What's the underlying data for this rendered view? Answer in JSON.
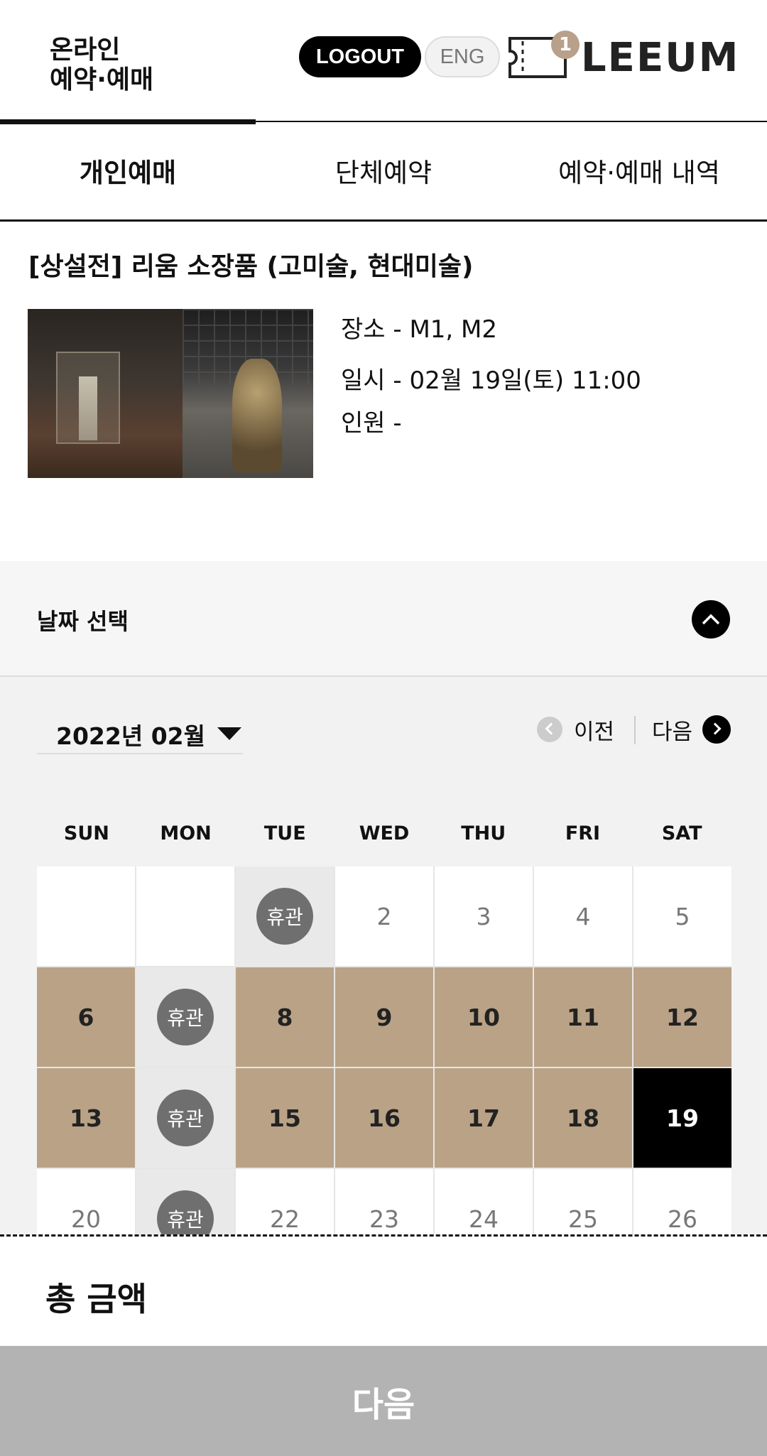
{
  "header": {
    "brand_line1": "온라인",
    "brand_line2": "예약·예매",
    "logout_label": "LOGOUT",
    "lang_label": "ENG",
    "cart_count": "1",
    "logo_text": "LEEUM"
  },
  "tabs": [
    {
      "label": "개인예매",
      "active": true
    },
    {
      "label": "단체예약",
      "active": false
    },
    {
      "label": "예약·예매 내역",
      "active": false
    }
  ],
  "exhibition": {
    "title": "[상설전] 리움 소장품 (고미술, 현대미술)",
    "place": "장소 - M1, M2",
    "datetime": "일시 - 02월 19일(토) 11:00",
    "people": "인원 -"
  },
  "date_select": {
    "title": "날짜 선택",
    "month": "2022년 02월",
    "prev_label": "이전",
    "next_label": "다음",
    "weekdays": [
      "SUN",
      "MON",
      "TUE",
      "WED",
      "THU",
      "FRI",
      "SAT"
    ],
    "closed_label": "휴관",
    "days": [
      {
        "label": "",
        "state": "empty"
      },
      {
        "label": "",
        "state": "empty"
      },
      {
        "label": "휴관",
        "state": "closed"
      },
      {
        "label": "2",
        "state": "default"
      },
      {
        "label": "3",
        "state": "default"
      },
      {
        "label": "4",
        "state": "default"
      },
      {
        "label": "5",
        "state": "default"
      },
      {
        "label": "6",
        "state": "available"
      },
      {
        "label": "휴관",
        "state": "closed"
      },
      {
        "label": "8",
        "state": "available"
      },
      {
        "label": "9",
        "state": "available"
      },
      {
        "label": "10",
        "state": "available"
      },
      {
        "label": "11",
        "state": "available"
      },
      {
        "label": "12",
        "state": "available"
      },
      {
        "label": "13",
        "state": "available"
      },
      {
        "label": "휴관",
        "state": "closed"
      },
      {
        "label": "15",
        "state": "available"
      },
      {
        "label": "16",
        "state": "available"
      },
      {
        "label": "17",
        "state": "available"
      },
      {
        "label": "18",
        "state": "available"
      },
      {
        "label": "19",
        "state": "selected"
      },
      {
        "label": "20",
        "state": "default"
      },
      {
        "label": "휴관",
        "state": "closed"
      },
      {
        "label": "22",
        "state": "default"
      },
      {
        "label": "23",
        "state": "default"
      },
      {
        "label": "24",
        "state": "default"
      },
      {
        "label": "25",
        "state": "default"
      },
      {
        "label": "26",
        "state": "default"
      }
    ]
  },
  "footer": {
    "total_label": "총 금액",
    "next_button": "다음"
  },
  "colors": {
    "available": "#baa286",
    "selected": "#000000",
    "closed_pill": "#6f6f6f",
    "badge": "#b8a08a",
    "disabled_button": "#b3b3b3"
  }
}
